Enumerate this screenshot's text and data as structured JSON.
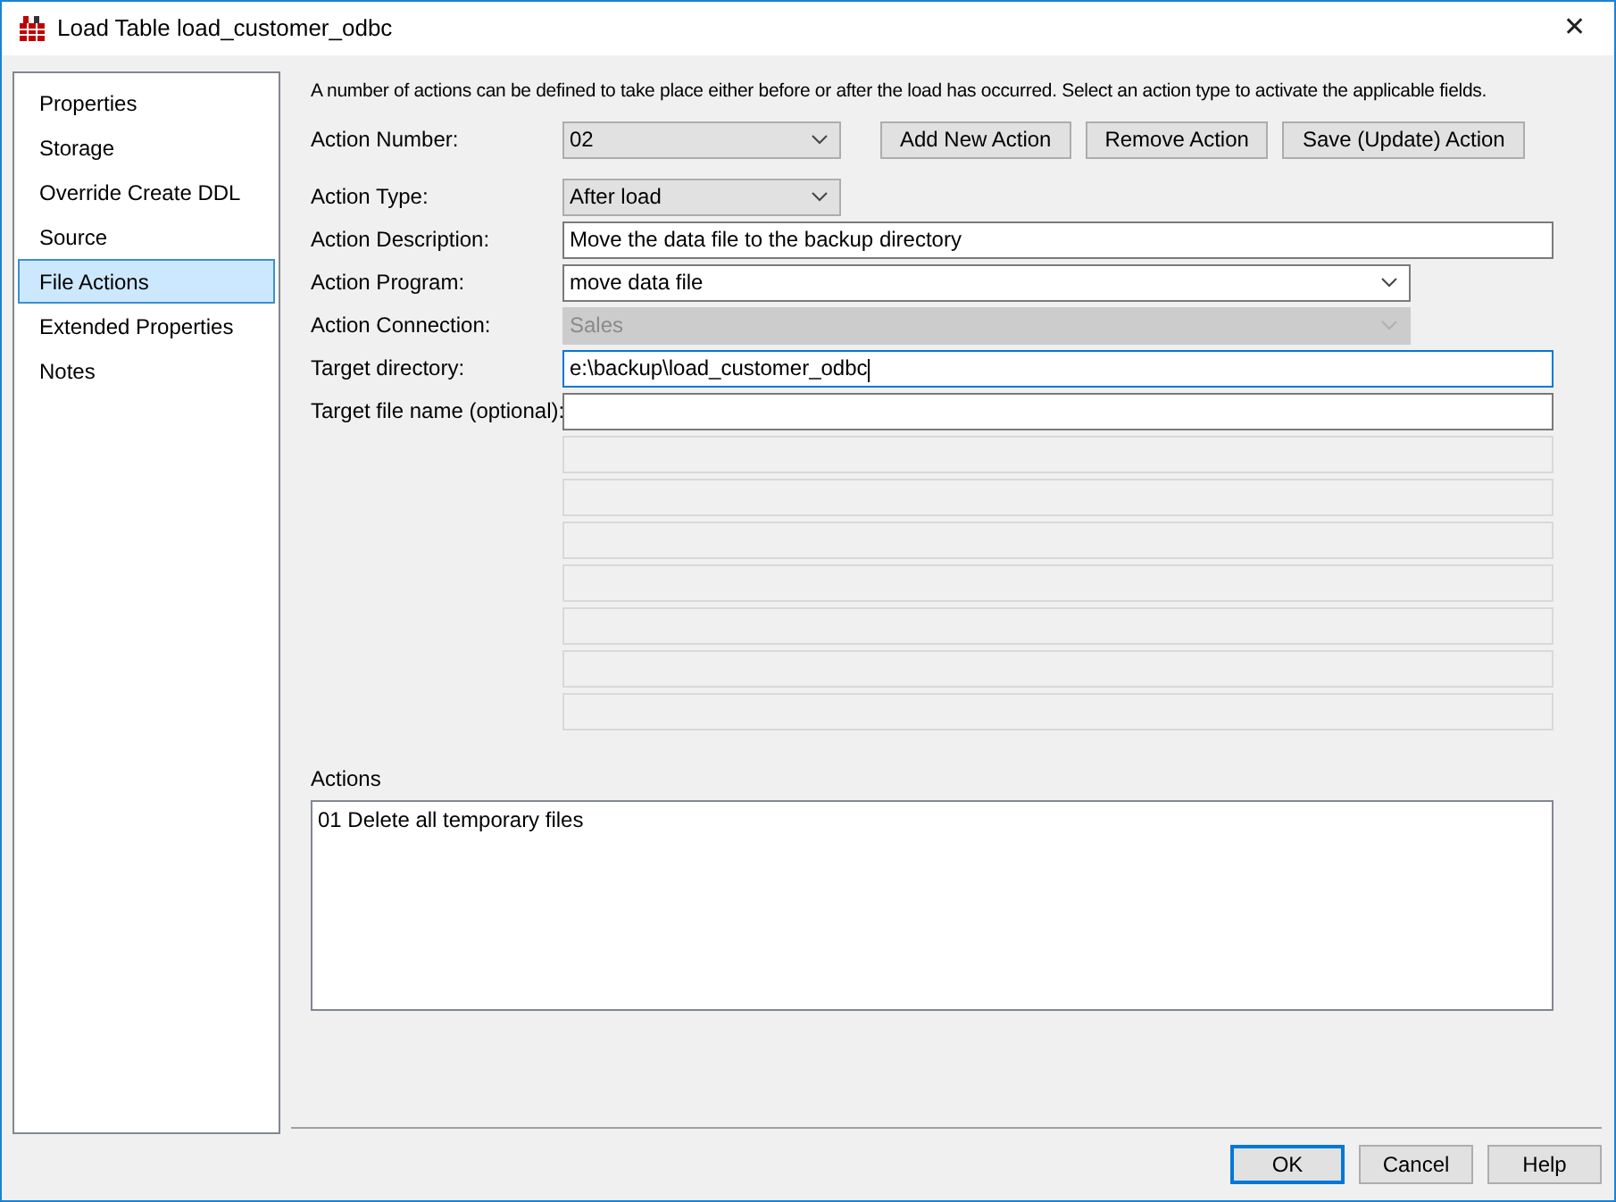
{
  "window": {
    "title": "Load Table load_customer_odbc",
    "close": "✕"
  },
  "sidebar": {
    "items": [
      {
        "label": "Properties",
        "selected": false
      },
      {
        "label": "Storage",
        "selected": false
      },
      {
        "label": "Override Create DDL",
        "selected": false
      },
      {
        "label": "Source",
        "selected": false
      },
      {
        "label": "File Actions",
        "selected": true
      },
      {
        "label": "Extended Properties",
        "selected": false
      },
      {
        "label": "Notes",
        "selected": false
      }
    ]
  },
  "intro": "A number of actions can be defined to take place either before or after the load has occurred. Select an action type to activate the applicable fields.",
  "fields": [
    {
      "label": "Action Number:",
      "kind": "short-dropdown",
      "value": "02",
      "disabled": false,
      "focused": false,
      "buttons": [
        "Add New Action",
        "Remove Action",
        "Save (Update) Action"
      ]
    },
    {
      "label": "Action Type:",
      "kind": "short-dropdown",
      "value": "After load",
      "disabled": false,
      "focused": false
    },
    {
      "label": "Action Description:",
      "kind": "text",
      "value": "Move the data file to the backup directory",
      "disabled": false,
      "focused": false
    },
    {
      "label": "Action Program:",
      "kind": "dropdown",
      "value": "move data file",
      "disabled": false,
      "focused": false
    },
    {
      "label": "Action Connection:",
      "kind": "dropdown",
      "value": "Sales",
      "disabled": true,
      "focused": false
    },
    {
      "label": "Target directory:",
      "kind": "text",
      "value": "e:\\backup\\load_customer_odbc",
      "disabled": false,
      "focused": true
    },
    {
      "label": "Target file name (optional):",
      "kind": "text",
      "disabled": false,
      "focused": false
    }
  ],
  "extra_fields": [
    {
      "disabled": true
    },
    {
      "disabled": true
    },
    {
      "disabled": true
    },
    {
      "disabled": true
    },
    {
      "disabled": true
    },
    {
      "disabled": true
    },
    {
      "disabled": true
    }
  ],
  "actions": {
    "label": "Actions",
    "items": [
      "01 Delete all temporary files"
    ]
  },
  "footer_buttons": [
    {
      "label": "OK",
      "default": true
    },
    {
      "label": "Cancel",
      "default": false
    },
    {
      "label": "Help",
      "default": false
    }
  ]
}
